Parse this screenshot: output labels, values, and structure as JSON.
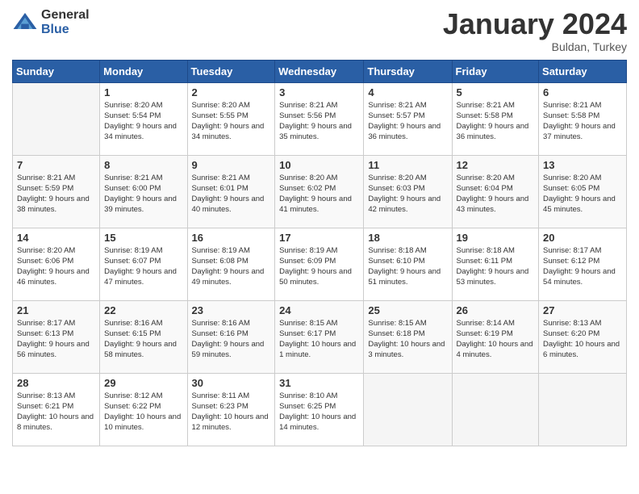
{
  "logo": {
    "general": "General",
    "blue": "Blue"
  },
  "header": {
    "month": "January 2024",
    "location": "Buldan, Turkey"
  },
  "weekdays": [
    "Sunday",
    "Monday",
    "Tuesday",
    "Wednesday",
    "Thursday",
    "Friday",
    "Saturday"
  ],
  "weeks": [
    [
      {
        "day": "",
        "sunrise": "",
        "sunset": "",
        "daylight": ""
      },
      {
        "day": "1",
        "sunrise": "Sunrise: 8:20 AM",
        "sunset": "Sunset: 5:54 PM",
        "daylight": "Daylight: 9 hours and 34 minutes."
      },
      {
        "day": "2",
        "sunrise": "Sunrise: 8:20 AM",
        "sunset": "Sunset: 5:55 PM",
        "daylight": "Daylight: 9 hours and 34 minutes."
      },
      {
        "day": "3",
        "sunrise": "Sunrise: 8:21 AM",
        "sunset": "Sunset: 5:56 PM",
        "daylight": "Daylight: 9 hours and 35 minutes."
      },
      {
        "day": "4",
        "sunrise": "Sunrise: 8:21 AM",
        "sunset": "Sunset: 5:57 PM",
        "daylight": "Daylight: 9 hours and 36 minutes."
      },
      {
        "day": "5",
        "sunrise": "Sunrise: 8:21 AM",
        "sunset": "Sunset: 5:58 PM",
        "daylight": "Daylight: 9 hours and 36 minutes."
      },
      {
        "day": "6",
        "sunrise": "Sunrise: 8:21 AM",
        "sunset": "Sunset: 5:58 PM",
        "daylight": "Daylight: 9 hours and 37 minutes."
      }
    ],
    [
      {
        "day": "7",
        "sunrise": "Sunrise: 8:21 AM",
        "sunset": "Sunset: 5:59 PM",
        "daylight": "Daylight: 9 hours and 38 minutes."
      },
      {
        "day": "8",
        "sunrise": "Sunrise: 8:21 AM",
        "sunset": "Sunset: 6:00 PM",
        "daylight": "Daylight: 9 hours and 39 minutes."
      },
      {
        "day": "9",
        "sunrise": "Sunrise: 8:21 AM",
        "sunset": "Sunset: 6:01 PM",
        "daylight": "Daylight: 9 hours and 40 minutes."
      },
      {
        "day": "10",
        "sunrise": "Sunrise: 8:20 AM",
        "sunset": "Sunset: 6:02 PM",
        "daylight": "Daylight: 9 hours and 41 minutes."
      },
      {
        "day": "11",
        "sunrise": "Sunrise: 8:20 AM",
        "sunset": "Sunset: 6:03 PM",
        "daylight": "Daylight: 9 hours and 42 minutes."
      },
      {
        "day": "12",
        "sunrise": "Sunrise: 8:20 AM",
        "sunset": "Sunset: 6:04 PM",
        "daylight": "Daylight: 9 hours and 43 minutes."
      },
      {
        "day": "13",
        "sunrise": "Sunrise: 8:20 AM",
        "sunset": "Sunset: 6:05 PM",
        "daylight": "Daylight: 9 hours and 45 minutes."
      }
    ],
    [
      {
        "day": "14",
        "sunrise": "Sunrise: 8:20 AM",
        "sunset": "Sunset: 6:06 PM",
        "daylight": "Daylight: 9 hours and 46 minutes."
      },
      {
        "day": "15",
        "sunrise": "Sunrise: 8:19 AM",
        "sunset": "Sunset: 6:07 PM",
        "daylight": "Daylight: 9 hours and 47 minutes."
      },
      {
        "day": "16",
        "sunrise": "Sunrise: 8:19 AM",
        "sunset": "Sunset: 6:08 PM",
        "daylight": "Daylight: 9 hours and 49 minutes."
      },
      {
        "day": "17",
        "sunrise": "Sunrise: 8:19 AM",
        "sunset": "Sunset: 6:09 PM",
        "daylight": "Daylight: 9 hours and 50 minutes."
      },
      {
        "day": "18",
        "sunrise": "Sunrise: 8:18 AM",
        "sunset": "Sunset: 6:10 PM",
        "daylight": "Daylight: 9 hours and 51 minutes."
      },
      {
        "day": "19",
        "sunrise": "Sunrise: 8:18 AM",
        "sunset": "Sunset: 6:11 PM",
        "daylight": "Daylight: 9 hours and 53 minutes."
      },
      {
        "day": "20",
        "sunrise": "Sunrise: 8:17 AM",
        "sunset": "Sunset: 6:12 PM",
        "daylight": "Daylight: 9 hours and 54 minutes."
      }
    ],
    [
      {
        "day": "21",
        "sunrise": "Sunrise: 8:17 AM",
        "sunset": "Sunset: 6:13 PM",
        "daylight": "Daylight: 9 hours and 56 minutes."
      },
      {
        "day": "22",
        "sunrise": "Sunrise: 8:16 AM",
        "sunset": "Sunset: 6:15 PM",
        "daylight": "Daylight: 9 hours and 58 minutes."
      },
      {
        "day": "23",
        "sunrise": "Sunrise: 8:16 AM",
        "sunset": "Sunset: 6:16 PM",
        "daylight": "Daylight: 9 hours and 59 minutes."
      },
      {
        "day": "24",
        "sunrise": "Sunrise: 8:15 AM",
        "sunset": "Sunset: 6:17 PM",
        "daylight": "Daylight: 10 hours and 1 minute."
      },
      {
        "day": "25",
        "sunrise": "Sunrise: 8:15 AM",
        "sunset": "Sunset: 6:18 PM",
        "daylight": "Daylight: 10 hours and 3 minutes."
      },
      {
        "day": "26",
        "sunrise": "Sunrise: 8:14 AM",
        "sunset": "Sunset: 6:19 PM",
        "daylight": "Daylight: 10 hours and 4 minutes."
      },
      {
        "day": "27",
        "sunrise": "Sunrise: 8:13 AM",
        "sunset": "Sunset: 6:20 PM",
        "daylight": "Daylight: 10 hours and 6 minutes."
      }
    ],
    [
      {
        "day": "28",
        "sunrise": "Sunrise: 8:13 AM",
        "sunset": "Sunset: 6:21 PM",
        "daylight": "Daylight: 10 hours and 8 minutes."
      },
      {
        "day": "29",
        "sunrise": "Sunrise: 8:12 AM",
        "sunset": "Sunset: 6:22 PM",
        "daylight": "Daylight: 10 hours and 10 minutes."
      },
      {
        "day": "30",
        "sunrise": "Sunrise: 8:11 AM",
        "sunset": "Sunset: 6:23 PM",
        "daylight": "Daylight: 10 hours and 12 minutes."
      },
      {
        "day": "31",
        "sunrise": "Sunrise: 8:10 AM",
        "sunset": "Sunset: 6:25 PM",
        "daylight": "Daylight: 10 hours and 14 minutes."
      },
      {
        "day": "",
        "sunrise": "",
        "sunset": "",
        "daylight": ""
      },
      {
        "day": "",
        "sunrise": "",
        "sunset": "",
        "daylight": ""
      },
      {
        "day": "",
        "sunrise": "",
        "sunset": "",
        "daylight": ""
      }
    ]
  ]
}
